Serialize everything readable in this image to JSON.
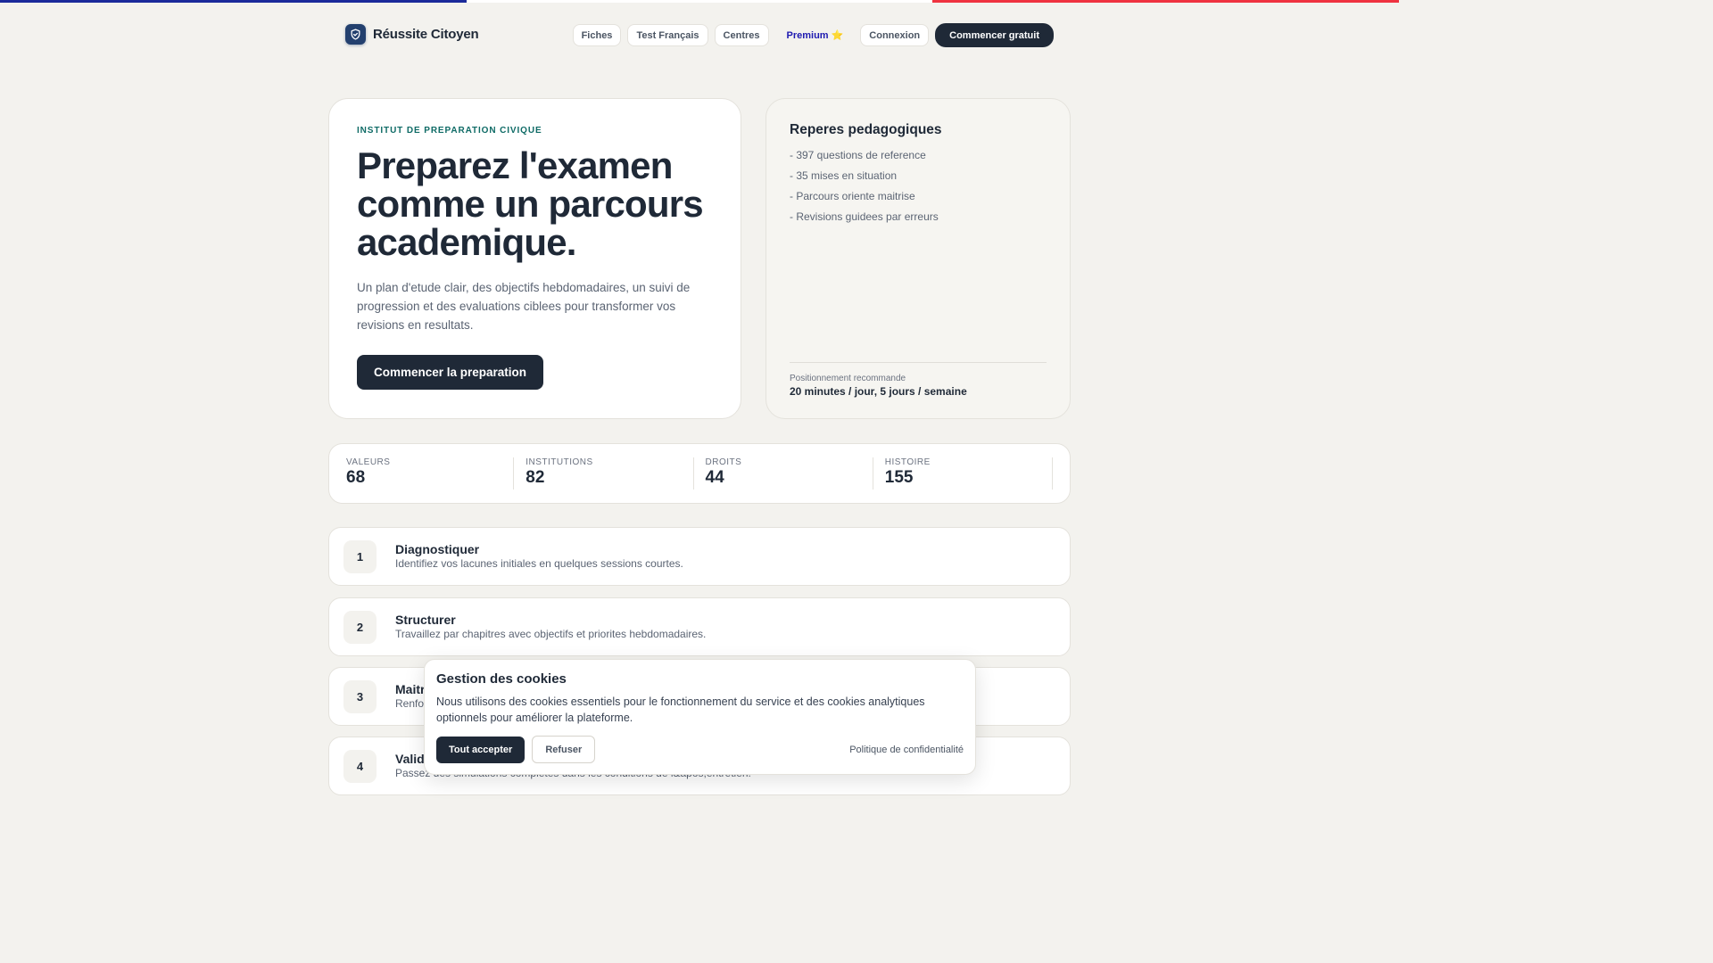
{
  "flag_colors": [
    "#1b2a9a",
    "#ffffff",
    "#ef3340"
  ],
  "brand": {
    "name": "Réussite Citoyen",
    "icon": "shield-check-icon"
  },
  "nav": {
    "items": [
      "Fiches",
      "Test Français",
      "Centres"
    ],
    "premium_label": "Premium",
    "premium_icon": "⭐",
    "login_label": "Connexion",
    "cta_label": "Commencer gratuit"
  },
  "hero": {
    "eyebrow": "INSTITUT DE PREPARATION CIVIQUE",
    "title_lines": [
      "Preparez l'examen",
      "comme un parcours",
      "academique."
    ],
    "description": "Un plan d'etude clair, des objectifs hebdomadaires, un suivi de progression et des evaluations ciblees pour transformer vos revisions en resultats.",
    "cta_label": "Commencer la preparation"
  },
  "side": {
    "title": "Reperes pedagogiques",
    "items": [
      "- 397 questions de reference",
      "- 35 mises en situation",
      "- Parcours oriente maitrise",
      "- Revisions guidees par erreurs"
    ],
    "footer_label": "Positionnement recommande",
    "footer_value": "20 minutes / jour, 5 jours / semaine"
  },
  "stats": [
    {
      "label": "VALEURS",
      "value": "68"
    },
    {
      "label": "INSTITUTIONS",
      "value": "82"
    },
    {
      "label": "DROITS",
      "value": "44"
    },
    {
      "label": "HISTOIRE",
      "value": "155"
    }
  ],
  "steps": [
    {
      "num": "1",
      "title": "Diagnostiquer",
      "desc": "Identifiez vos lacunes initiales en quelques sessions courtes."
    },
    {
      "num": "2",
      "title": "Structurer",
      "desc": "Travaillez par chapitres avec objectifs et priorites hebdomadaires."
    },
    {
      "num": "3",
      "title": "Maitriser",
      "desc": "Renforcez"
    },
    {
      "num": "4",
      "title": "Valider",
      "desc": "Passez des simulations completes dans les conditions de l&apos;entretien."
    }
  ],
  "cookie": {
    "title": "Gestion des cookies",
    "text": "Nous utilisons des cookies essentiels pour le fonctionnement du service et des cookies analytiques optionnels pour améliorer la plateforme.",
    "accept_label": "Tout accepter",
    "refuse_label": "Refuser",
    "privacy_label": "Politique de confidentialité"
  }
}
